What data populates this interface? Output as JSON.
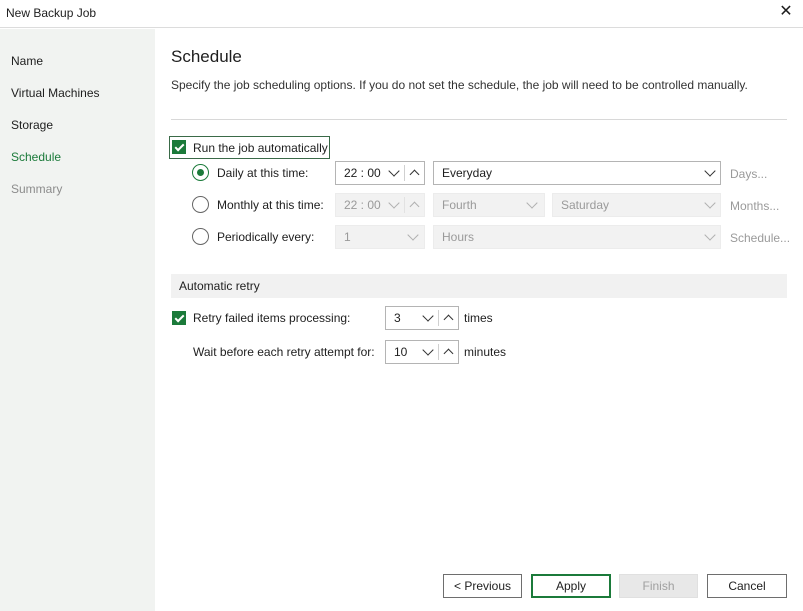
{
  "window": {
    "title": "New Backup Job",
    "close_glyph": "✕"
  },
  "sidebar": {
    "items": [
      {
        "label": "Name",
        "state": "normal"
      },
      {
        "label": "Virtual Machines",
        "state": "normal"
      },
      {
        "label": "Storage",
        "state": "normal"
      },
      {
        "label": "Schedule",
        "state": "active"
      },
      {
        "label": "Summary",
        "state": "disabled"
      }
    ]
  },
  "main": {
    "heading": "Schedule",
    "description": "Specify the job scheduling options. If you do not set the schedule, the job will need to be controlled manually."
  },
  "schedule": {
    "run_auto": {
      "label": "Run the job automatically",
      "checked": true
    },
    "daily": {
      "label": "Daily at this time:",
      "selected": true,
      "time": "22 : 00",
      "frequency": "Everyday",
      "link": "Days..."
    },
    "monthly": {
      "label": "Monthly at this time:",
      "selected": false,
      "time": "22 : 00",
      "week": "Fourth",
      "day": "Saturday",
      "link": "Months..."
    },
    "periodic": {
      "label": "Periodically every:",
      "selected": false,
      "interval": "1",
      "unit": "Hours",
      "link": "Schedule..."
    }
  },
  "retry": {
    "section_title": "Automatic retry",
    "retry_failed": {
      "label": "Retry failed items processing:",
      "checked": true,
      "value": "3",
      "unit": "times"
    },
    "wait": {
      "label": "Wait before each retry attempt for:",
      "value": "10",
      "unit": "minutes"
    }
  },
  "buttons": {
    "previous": "< Previous",
    "apply": "Apply",
    "finish": "Finish",
    "cancel": "Cancel"
  },
  "colors": {
    "accent": "#1b7a3a",
    "sidebar_bg": "#f1f3f1"
  }
}
